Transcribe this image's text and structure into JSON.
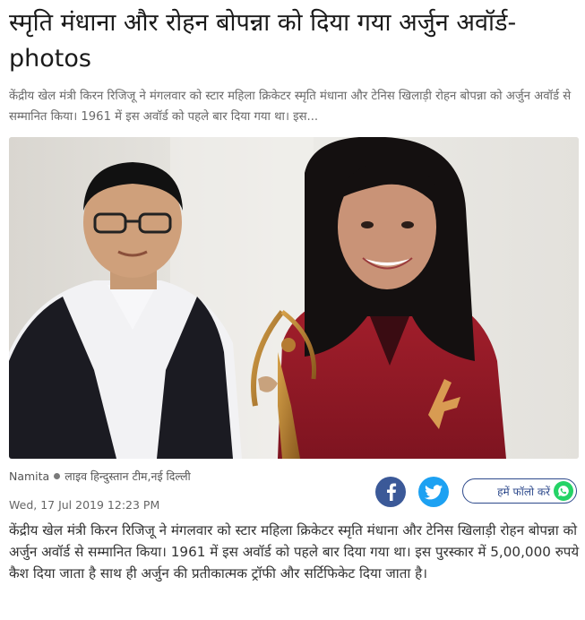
{
  "article": {
    "headline": "स्मृति मंधाना और रोहन बोपन्ना को दिया गया अर्जुन अवॉर्ड- photos",
    "summary": "केंद्रीय खेल मंत्री किरन रिजिजू ने मंगलवार को स्टार महिला क्रिकेटर स्मृति मंधाना और टेनिस खिलाड़ी रोहन बोपन्ना को अर्जुन अवॉर्ड से सम्मानित किया। 1961 में इस अवॉर्ड को पहले बार दिया गया था। इस...",
    "author": "Namita",
    "source": "लाइव हिन्दुस्तान टीम,नई दिल्ली",
    "date": "Wed, 17 Jul 2019 12:23 PM",
    "body": "केंद्रीय खेल मंत्री किरन रिजिजू ने मंगलवार को स्टार महिला क्रिकेटर स्मृति मंधाना और टेनिस खिलाड़ी रोहन बोपन्ना को अर्जुन अवॉर्ड से सम्मानित किया। 1961 में इस अवॉर्ड को पहले बार दिया गया था। इस पुरस्कार में 5,00,000 रुपये कैश दिया जाता है साथ ही अर्जुन की प्रतीकात्मक ट्रॉफी और सर्टिफिकेट दिया जाता है।"
  },
  "share": {
    "facebook_icon": "facebook-icon",
    "twitter_icon": "twitter-icon",
    "follow_label": "हमें फॉलो करें",
    "whatsapp_icon": "whatsapp-icon"
  },
  "colors": {
    "facebook": "#3b5998",
    "twitter": "#1da1f2",
    "whatsapp": "#25d366",
    "follow_border": "#2e4a8c"
  }
}
